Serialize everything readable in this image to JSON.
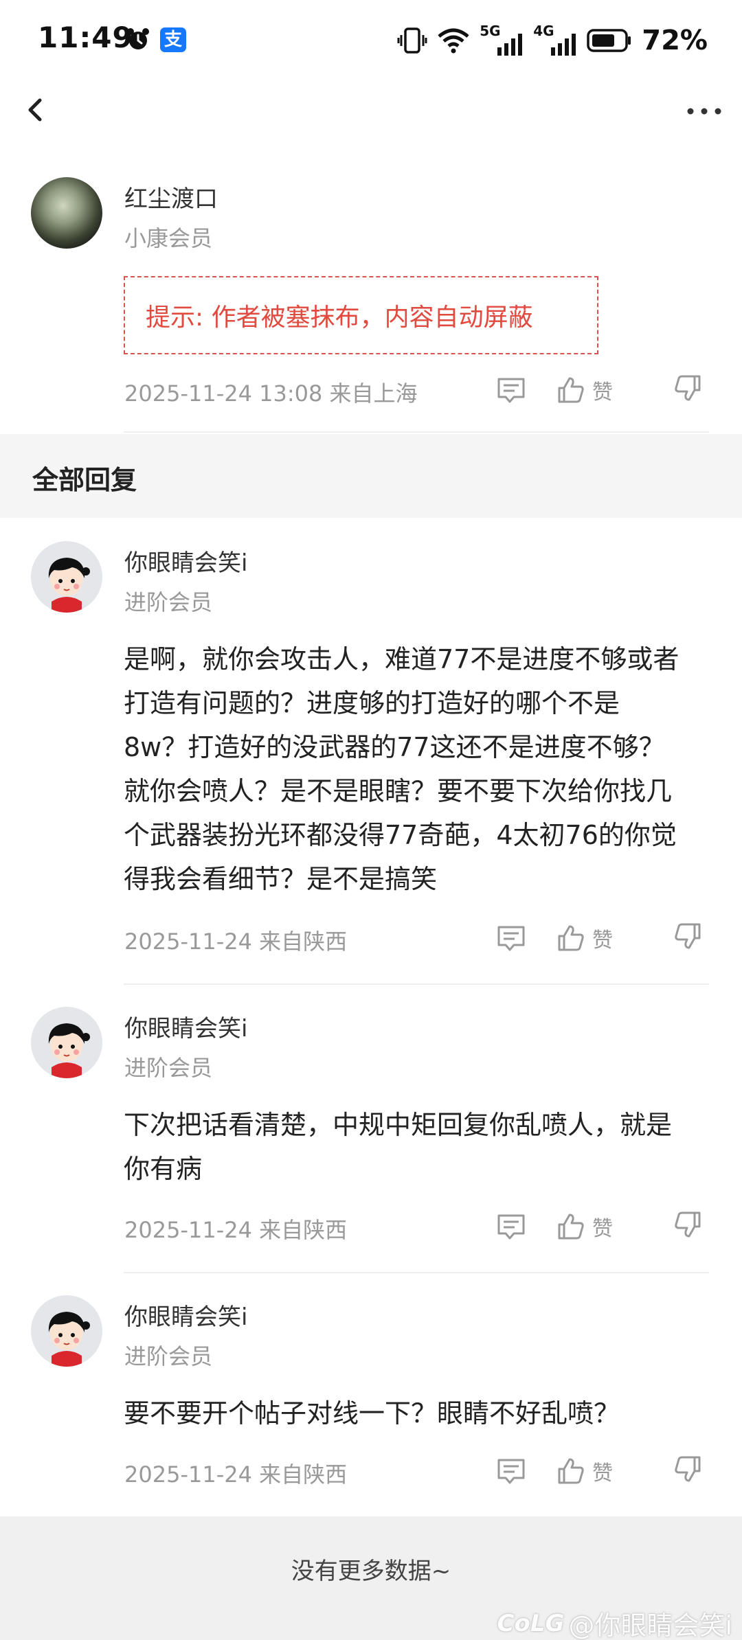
{
  "status_bar": {
    "time": "11:49",
    "alipay_glyph": "支",
    "battery": "72%",
    "network_5g": "5G",
    "network_4g": "4G"
  },
  "post": {
    "author": "红尘渡口",
    "badge": "小康会员",
    "notice": "提示: 作者被塞抹布，内容自动屏蔽",
    "meta": "2025-11-24 13:08  来自上海",
    "like_label": "赞"
  },
  "section": {
    "title": "全部回复"
  },
  "replies": [
    {
      "name": "你眼睛会笑i",
      "badge": "进阶会员",
      "lines": [
        "是啊，就你会攻击人，难道77不是进度不够或者",
        "打造有问题的？进度够的打造好的哪个不是",
        "8w？打造好的没武器的77这还不是进度不够？",
        "就你会喷人？是不是眼瞎？要不要下次给你找几",
        "个武器装扮光环都没得77奇葩，4太初76的你觉",
        "得我会看细节？是不是搞笑"
      ],
      "meta": "2025-11-24 来自陕西",
      "like_label": "赞"
    },
    {
      "name": "你眼睛会笑i",
      "badge": "进阶会员",
      "lines": [
        "下次把话看清楚，中规中矩回复你乱喷人，就是",
        "你有病"
      ],
      "meta": "2025-11-24 来自陕西",
      "like_label": "赞"
    },
    {
      "name": "你眼睛会笑i",
      "badge": "进阶会员",
      "lines": [
        "要不要开个帖子对线一下？眼睛不好乱喷？"
      ],
      "meta": "2025-11-24 来自陕西",
      "like_label": "赞"
    }
  ],
  "footer": {
    "text": "没有更多数据~",
    "watermark_logo": "CoLG",
    "watermark_text": "@你眼睛会笑i"
  },
  "colors": {
    "notice_red": "#e04a3f",
    "muted_gray": "#999999",
    "section_bg": "#f5f5f5",
    "alipay_blue": "#1677ff"
  },
  "icons": [
    "alarm-icon",
    "alipay-icon",
    "vibrate-icon",
    "wifi-icon",
    "signal-icon",
    "battery-icon",
    "back-icon",
    "more-icon",
    "comment-icon",
    "thumbs-up-icon",
    "thumbs-down-icon"
  ]
}
